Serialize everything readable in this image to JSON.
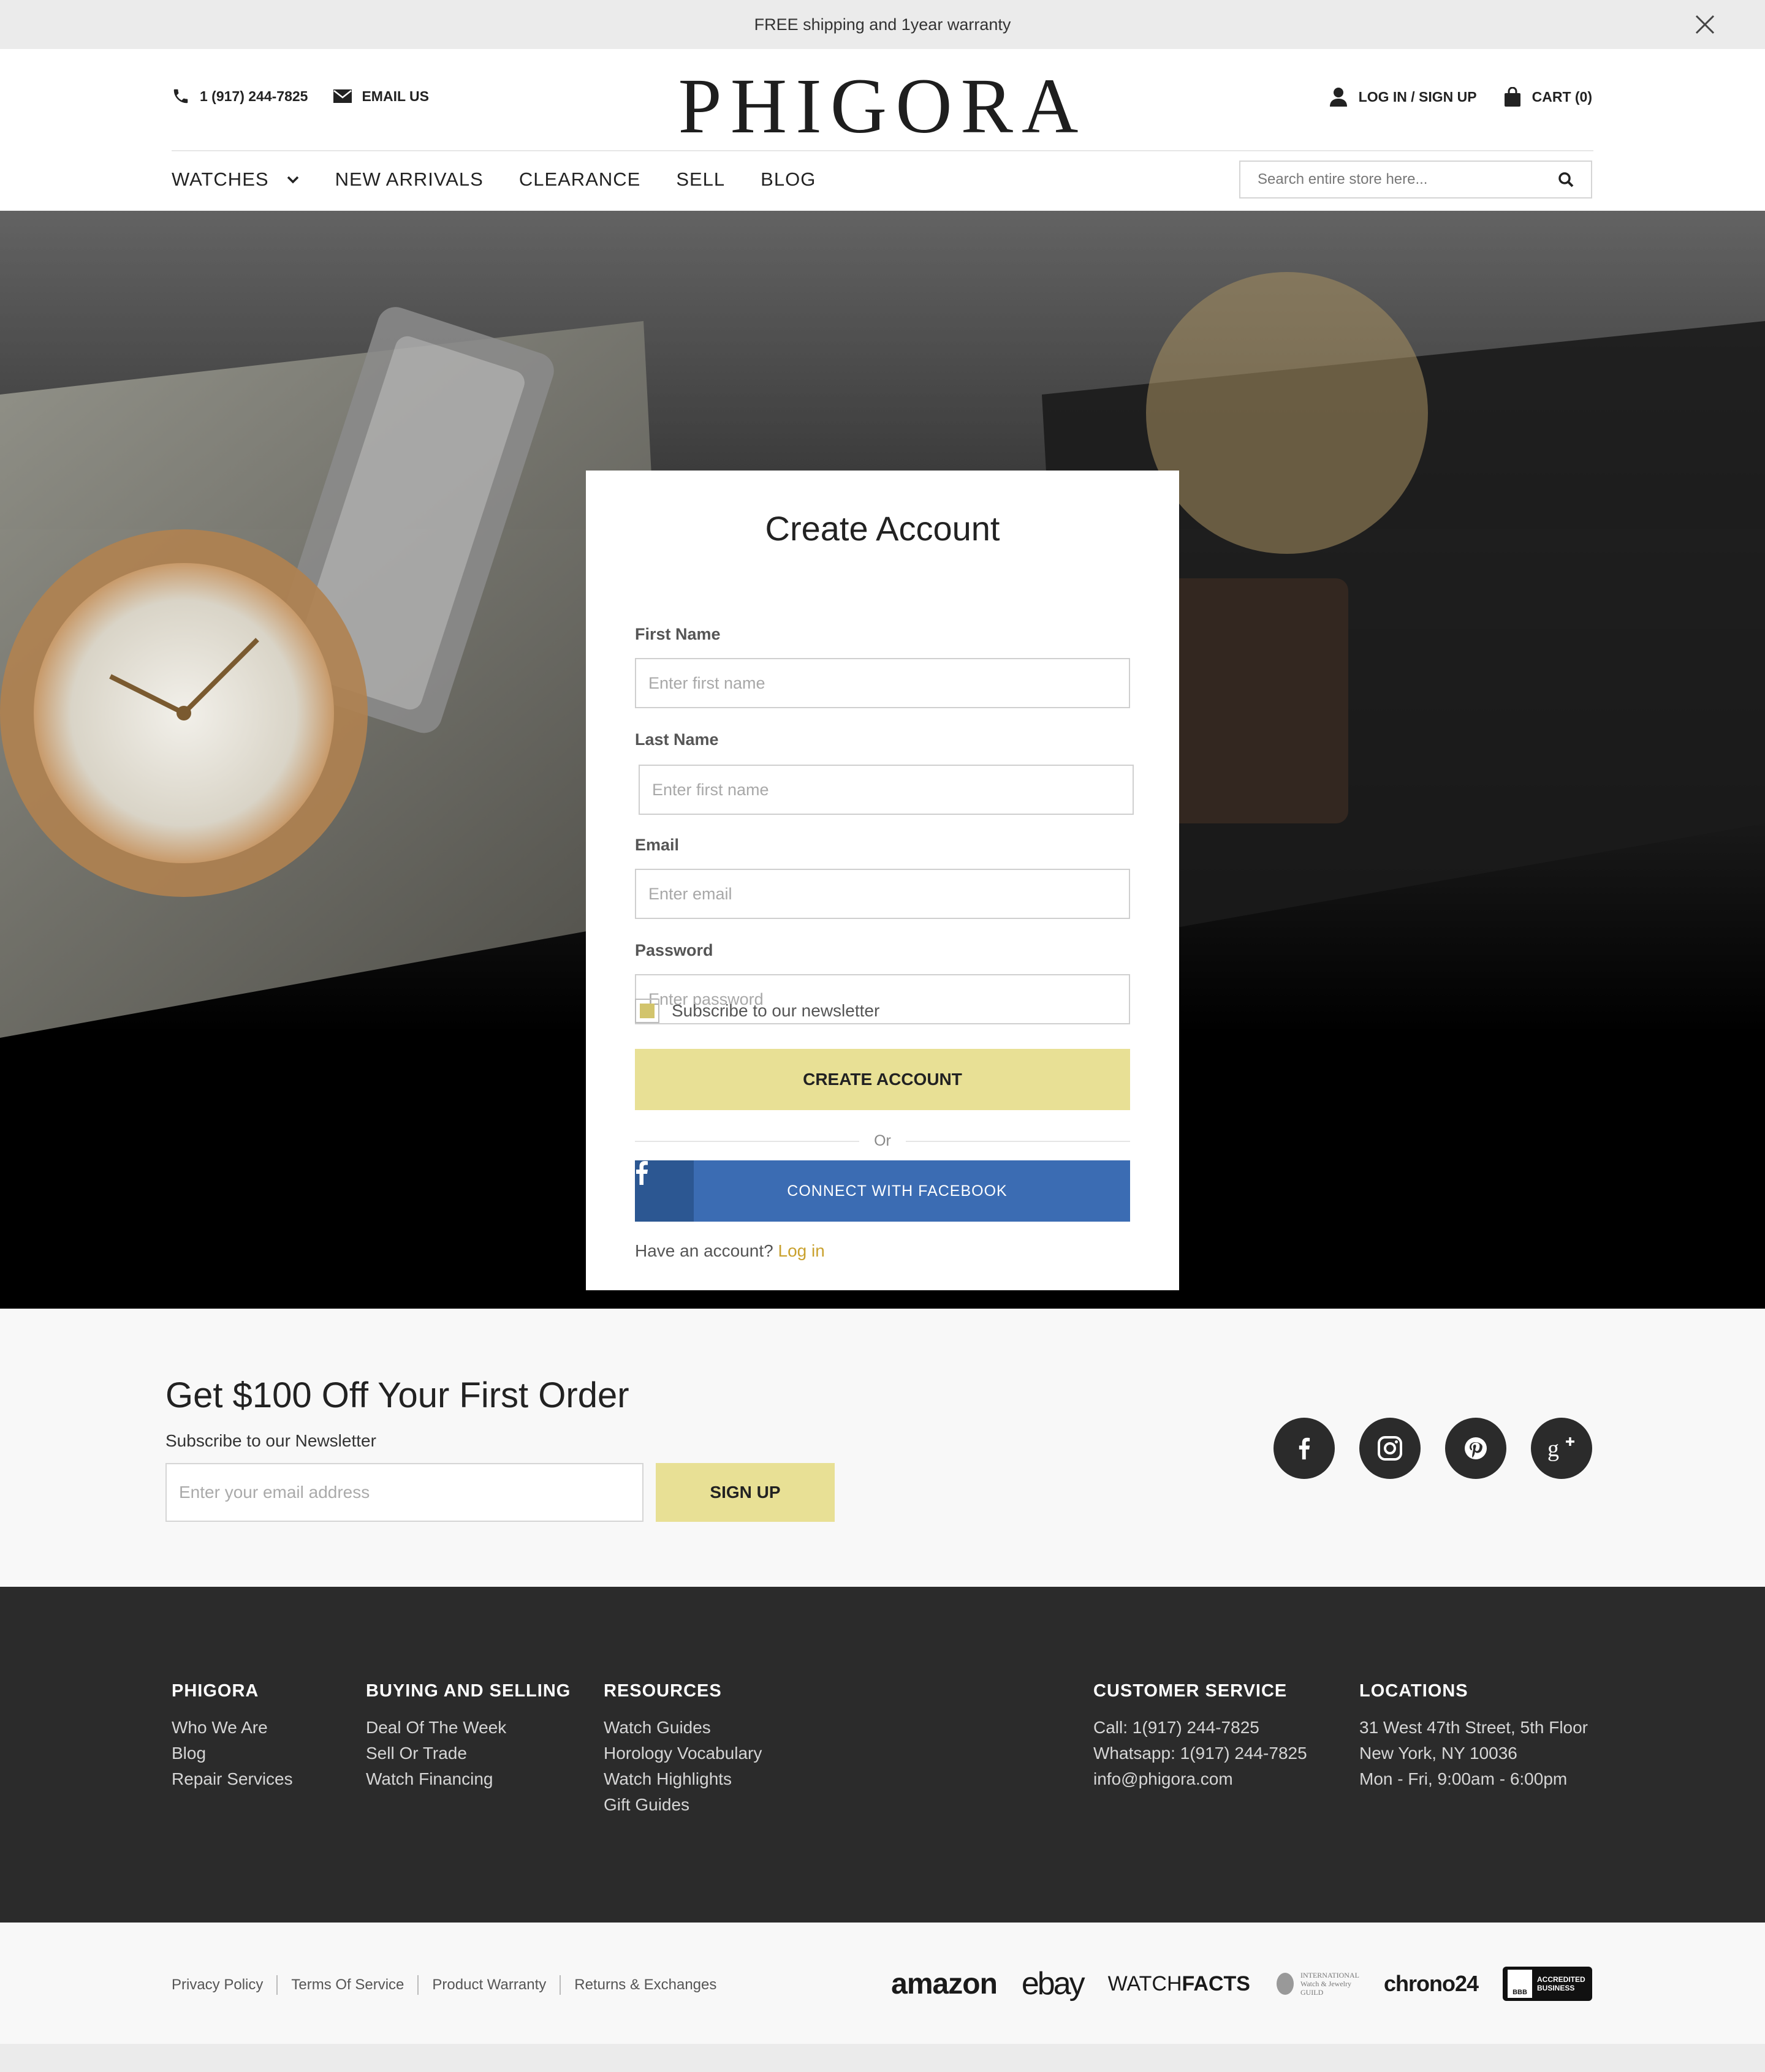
{
  "announcement": {
    "text": "FREE shipping and  1year warranty"
  },
  "header": {
    "phone": "1 (917) 244-7825",
    "email_label": "EMAIL US",
    "logo": "PHIGORA",
    "login_label": "LOG IN / SIGN UP",
    "cart_label": "CART (0)"
  },
  "nav": {
    "items": [
      "WATCHES",
      "NEW ARRIVALS",
      "CLEARANCE",
      "SELL",
      "BLOG"
    ],
    "search_placeholder": "Search entire store here..."
  },
  "form": {
    "title": "Create Account",
    "first_name_label": "First Name",
    "first_name_placeholder": "Enter first name",
    "last_name_label": "Last Name",
    "last_name_placeholder": "Enter first name",
    "email_label": "Email",
    "email_placeholder": "Enter email",
    "password_label": "Password",
    "password_placeholder": "Enter password",
    "newsletter_label": "Subscribe to our newsletter",
    "newsletter_checked": true,
    "create_button": "CREATE ACCOUNT",
    "or_text": "Or",
    "facebook_button": "CONNECT WITH FACEBOOK",
    "have_account_text": "Have an account?",
    "login_link": "Log in"
  },
  "newsletter": {
    "heading": "Get $100 Off Your First Order",
    "subheading": "Subscribe to our Newsletter",
    "input_placeholder": "Enter your email address",
    "button": "SIGN UP",
    "social_icons": [
      "facebook-icon",
      "instagram-icon",
      "pinterest-icon",
      "google-plus-icon"
    ]
  },
  "footer": {
    "columns": [
      {
        "title": "PHIGORA",
        "links": [
          "Who We Are",
          "Blog",
          "Repair Services"
        ]
      },
      {
        "title": "BUYING AND SELLING",
        "links": [
          "Deal Of The Week",
          "Sell Or Trade",
          "Watch Financing"
        ]
      },
      {
        "title": "RESOURCES",
        "links": [
          "Watch Guides",
          "Horology Vocabulary",
          "Watch Highlights",
          "Gift Guides"
        ]
      },
      {
        "title": "CUSTOMER SERVICE",
        "links": [
          "Call: 1(917) 244-7825",
          "Whatsapp: 1(917) 244-7825",
          "info@phigora.com"
        ]
      },
      {
        "title": "LOCATIONS",
        "links": [
          "31 West 47th Street, 5th Floor",
          "New York, NY 10036",
          "Mon - Fri, 9:00am - 6:00pm"
        ]
      }
    ]
  },
  "bottom": {
    "legal_links": [
      "Privacy Policy",
      "Terms Of Service",
      "Product Warranty",
      "Returns & Exchanges"
    ],
    "partners": {
      "amazon": "amazon",
      "ebay": "ebay",
      "watchfacts_a": "WATCH",
      "watchfacts_b": "FACTS",
      "guild_line1": "INTERNATIONAL",
      "guild_line2": "Watch & Jewelry",
      "guild_line3": "GUILD",
      "chrono": "chrono24",
      "bbb_line1": "ACCREDITED",
      "bbb_line2": "BUSINESS",
      "bbb_mark": "BBB"
    }
  },
  "colors": {
    "accent_yellow": "#e8e095",
    "facebook_blue": "#3b6cb3",
    "link_gold": "#c9a12e",
    "footer_dark": "#2b2b2b"
  }
}
